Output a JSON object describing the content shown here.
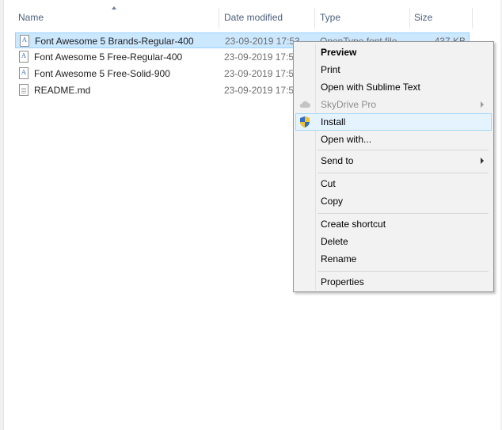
{
  "columns": {
    "name": "Name",
    "date_modified": "Date modified",
    "type": "Type",
    "size": "Size"
  },
  "files": [
    {
      "name": "Font Awesome 5 Brands-Regular-400",
      "date": "23-09-2019 17:53",
      "type": "OpenType font file",
      "size": "437 KB",
      "icon": "font-file-icon",
      "selected": true
    },
    {
      "name": "Font Awesome 5 Free-Regular-400",
      "date": "23-09-2019 17:53",
      "type": "",
      "size": "",
      "icon": "font-file-icon",
      "selected": false
    },
    {
      "name": "Font Awesome 5 Free-Solid-900",
      "date": "23-09-2019 17:53",
      "type": "",
      "size": "",
      "icon": "font-file-icon",
      "selected": false
    },
    {
      "name": "README.md",
      "date": "23-09-2019 17:53",
      "type": "",
      "size": "",
      "icon": "text-file-icon",
      "selected": false
    }
  ],
  "context_menu": {
    "preview": "Preview",
    "print": "Print",
    "open_sublime": "Open with Sublime Text",
    "skydrive": "SkyDrive Pro",
    "install": "Install",
    "open_with": "Open with...",
    "send_to": "Send to",
    "cut": "Cut",
    "copy": "Copy",
    "create_shortcut": "Create shortcut",
    "delete": "Delete",
    "rename": "Rename",
    "properties": "Properties"
  },
  "colors": {
    "selection": "#cce8ff",
    "hover": "#e5f3ff",
    "header_text": "#4c607a"
  }
}
